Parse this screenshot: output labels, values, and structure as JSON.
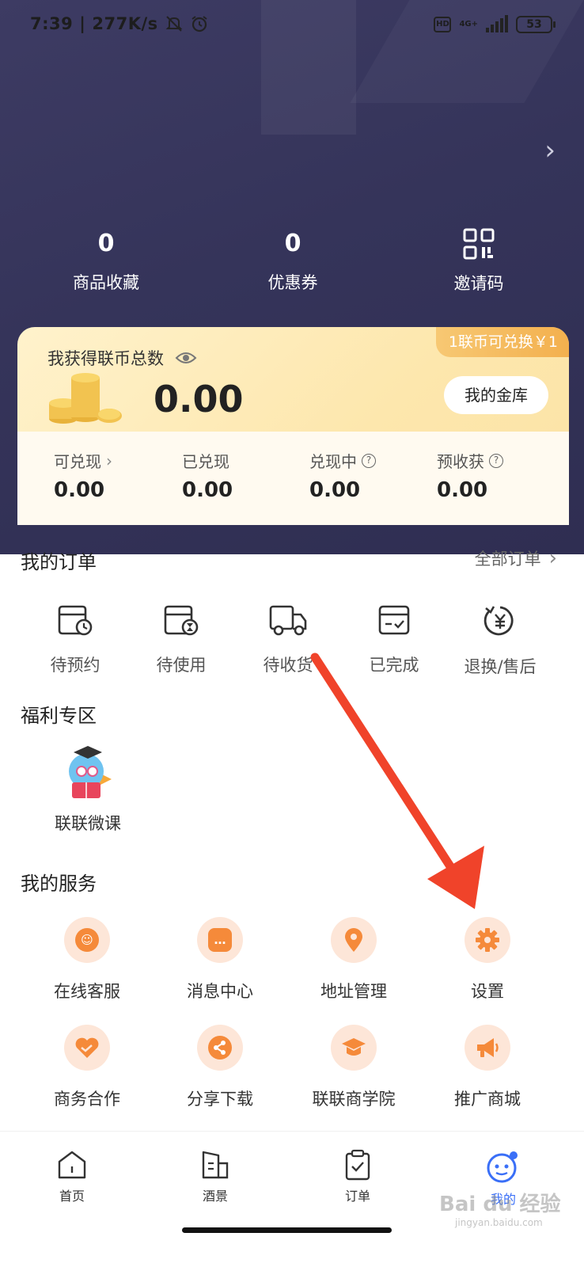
{
  "status_bar": {
    "time": "7:39",
    "speed": "277K/s",
    "network": "4G+",
    "battery": "53"
  },
  "stats": [
    {
      "value": "0",
      "label": "商品收藏"
    },
    {
      "value": "0",
      "label": "优惠券"
    },
    {
      "label": "邀请码"
    }
  ],
  "coin_card": {
    "ribbon": "1联币可兑换￥1",
    "title": "我获得联币总数",
    "amount": "0.00",
    "vault_button": "我的金库",
    "columns": [
      {
        "label": "可兑现",
        "value": "0.00",
        "icon": "chevron-right-icon"
      },
      {
        "label": "已兑现",
        "value": "0.00"
      },
      {
        "label": "兑现中",
        "value": "0.00",
        "icon": "help-icon"
      },
      {
        "label": "预收获",
        "value": "0.00",
        "icon": "help-icon"
      }
    ]
  },
  "orders": {
    "title": "我的订单",
    "all_label": "全部订单",
    "items": [
      {
        "label": "待预约",
        "icon": "calendar-clock-icon"
      },
      {
        "label": "待使用",
        "icon": "ticket-hourglass-icon"
      },
      {
        "label": "待收货",
        "icon": "truck-icon"
      },
      {
        "label": "已完成",
        "icon": "box-check-icon"
      },
      {
        "label": "退换/售后",
        "icon": "refund-icon"
      }
    ]
  },
  "welfare": {
    "title": "福利专区",
    "items": [
      {
        "label": "联联微课",
        "icon": "micro-course-icon"
      }
    ]
  },
  "services": {
    "title": "我的服务",
    "items": [
      {
        "label": "在线客服",
        "icon": "customer-service-icon"
      },
      {
        "label": "消息中心",
        "icon": "message-icon"
      },
      {
        "label": "地址管理",
        "icon": "location-pin-icon"
      },
      {
        "label": "设置",
        "icon": "gear-icon"
      },
      {
        "label": "商务合作",
        "icon": "handshake-icon"
      },
      {
        "label": "分享下载",
        "icon": "share-icon"
      },
      {
        "label": "联联商学院",
        "icon": "graduation-cap-icon"
      },
      {
        "label": "推广商城",
        "icon": "megaphone-icon"
      }
    ]
  },
  "tabbar": [
    {
      "label": "首页",
      "icon": "home-icon"
    },
    {
      "label": "酒景",
      "icon": "hotel-icon"
    },
    {
      "label": "订单",
      "icon": "order-clipboard-icon"
    },
    {
      "label": "我的",
      "icon": "profile-face-icon"
    }
  ],
  "watermark": {
    "text": "Bai du 经验",
    "sub": "jingyan.baidu.com"
  },
  "colors": {
    "header_bg": "#35345a",
    "accent_orange": "#f58a3a",
    "service_circle": "#fde6d8",
    "coin_card_bg": "#fde7ad",
    "annotation_arrow": "#f0432a",
    "active_tab": "#3a6ff7"
  }
}
